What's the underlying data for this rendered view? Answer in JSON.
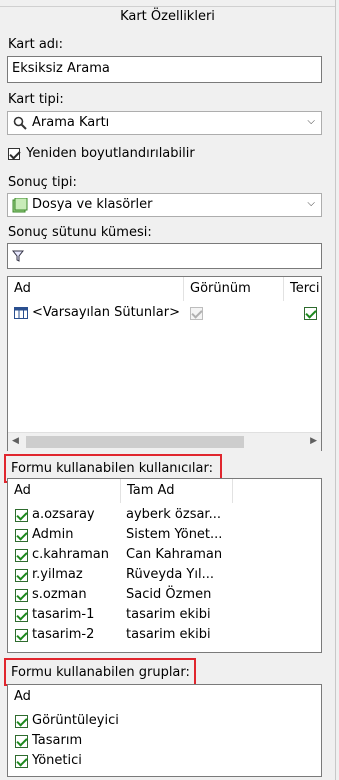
{
  "panel_title": "Kart Özellikleri",
  "card_name": {
    "label": "Kart adı:",
    "value": "Eksiksiz Arama"
  },
  "card_type": {
    "label": "Kart tipi:",
    "value": "Arama Kartı"
  },
  "resizable": {
    "label": "Yeniden boyutlandırılabilir",
    "checked": true
  },
  "result_type": {
    "label": "Sonuç tipi:",
    "value": "Dosya ve klasörler"
  },
  "result_columns": {
    "label": "Sonuç sütunu kümesi:",
    "headers": [
      "Ad",
      "Görünüm",
      "Terci"
    ],
    "rows": [
      {
        "name": "<Varsayılan Sütunlar>"
      }
    ]
  },
  "users": {
    "label": "Formu kullanabilen kullanıcılar:",
    "headers": [
      "Ad",
      "Tam Ad"
    ],
    "rows": [
      {
        "name": "a.ozsaray",
        "full": "ayberk özsar..."
      },
      {
        "name": "Admin",
        "full": "Sistem Yönet..."
      },
      {
        "name": "c.kahraman",
        "full": "Can Kahraman"
      },
      {
        "name": "r.yilmaz",
        "full": "Rüveyda Yıl..."
      },
      {
        "name": "s.ozman",
        "full": "Sacid Özmen"
      },
      {
        "name": "tasarim-1",
        "full": "tasarim ekibi"
      },
      {
        "name": "tasarim-2",
        "full": "tasarim ekibi"
      }
    ]
  },
  "groups": {
    "label": "Formu kullanabilen gruplar:",
    "headers": [
      "Ad"
    ],
    "rows": [
      {
        "name": "Görüntüleyici"
      },
      {
        "name": "Tasarım"
      },
      {
        "name": "Yönetici"
      }
    ]
  },
  "colors": {
    "accent_red": "#e0262e",
    "check_green": "#1d8a1d"
  }
}
